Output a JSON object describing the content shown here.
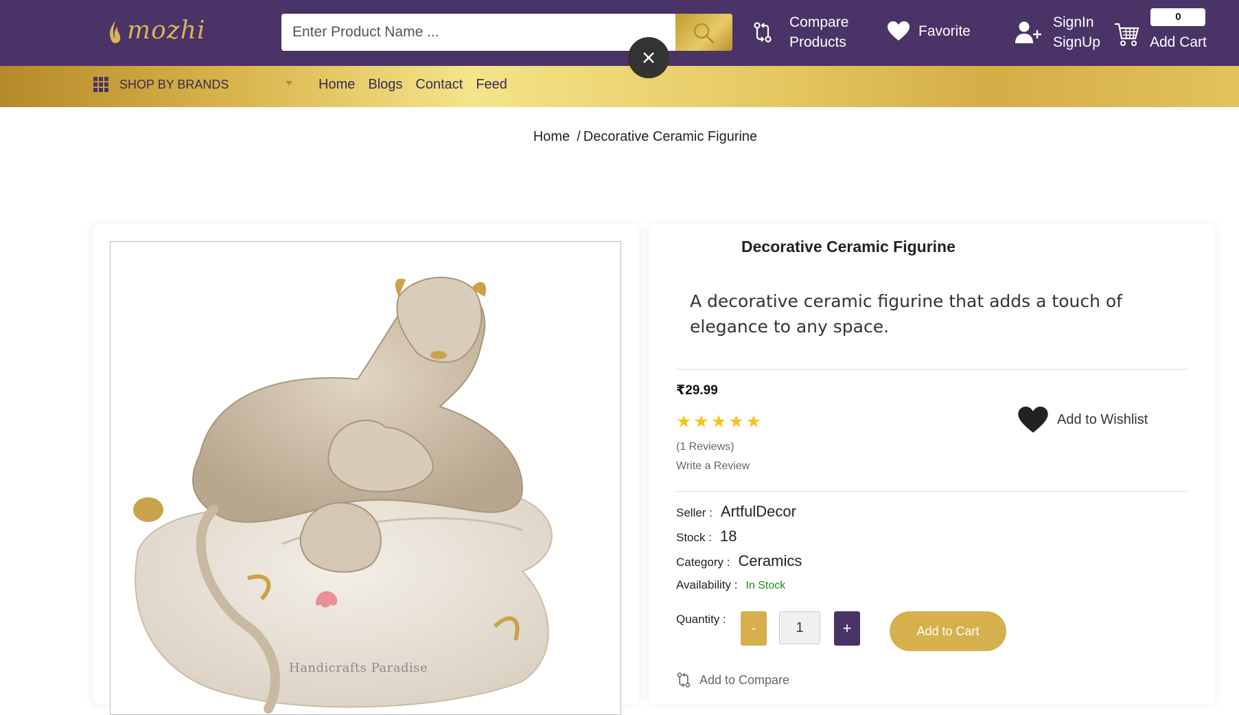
{
  "header": {
    "logo_text": "mozhi",
    "search_placeholder": "Enter Product Name ...",
    "compare_line1": "Compare",
    "compare_line2": "Products",
    "favorite_label": "Favorite",
    "signin_label": "SignIn",
    "signup_label": "SignUp",
    "cart_count": "0",
    "cart_label": "Add Cart"
  },
  "nav": {
    "brands_label": "SHOP BY BRANDS",
    "links": [
      "Home",
      "Blogs",
      "Contact",
      "Feed"
    ]
  },
  "breadcrumb": {
    "home": "Home",
    "separator": "/",
    "current": "Decorative Ceramic Figurine"
  },
  "product": {
    "image_watermark": "Handicrafts Paradise",
    "title": "Decorative Ceramic Figurine",
    "description": "A decorative ceramic figurine that adds a touch of elegance to any space.",
    "price": "₹29.99",
    "rating": 5,
    "rating_max": 5,
    "reviews_text": "(1 Reviews)",
    "write_review": "Write a Review",
    "wishlist_label": "Add to Wishlist",
    "seller_label": "Seller :",
    "seller": "ArtfulDecor",
    "stock_label": "Stock :",
    "stock": "18",
    "category_label": "Category :",
    "category": "Ceramics",
    "availability_label": "Availability :",
    "availability": "In Stock",
    "quantity_label": "Quantity :",
    "quantity_minus": "-",
    "quantity_value": "1",
    "quantity_plus": "+",
    "add_to_cart": "Add to Cart",
    "add_to_compare": "Add to Compare"
  },
  "colors": {
    "header_bg": "#4a3366",
    "gold": "#d6b04c",
    "in_stock": "#1a8a1a",
    "star": "#f5c518"
  }
}
